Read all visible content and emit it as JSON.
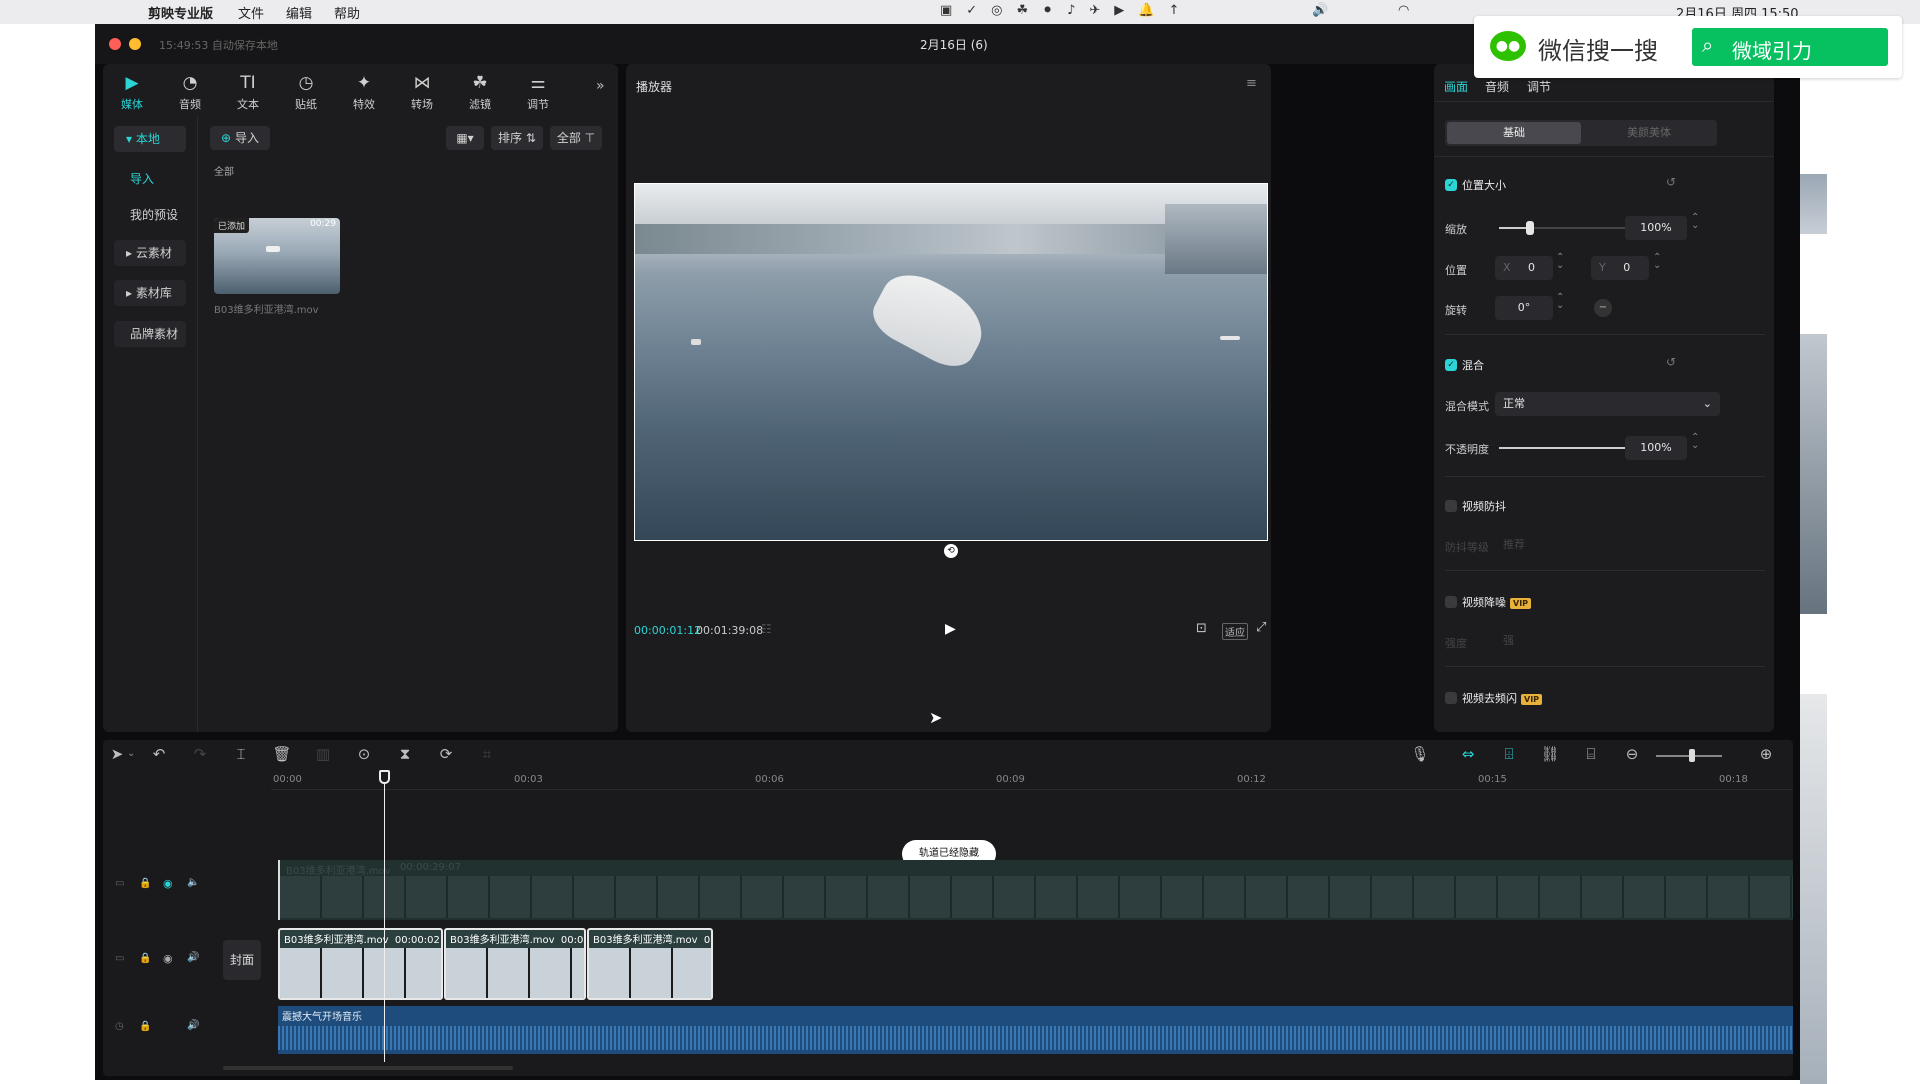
{
  "menubar": {
    "app": "剪映专业版",
    "items": [
      "文件",
      "编辑",
      "帮助"
    ],
    "clock": "2月16日 周四 15:50"
  },
  "window": {
    "title": "2月16日 (6)",
    "autosave": "15:49:53 自动保存本地"
  },
  "toolbar": [
    {
      "icon": "media-icon",
      "label": "媒体"
    },
    {
      "icon": "audio-icon",
      "label": "音频"
    },
    {
      "icon": "text-icon",
      "label": "文本"
    },
    {
      "icon": "sticker-icon",
      "label": "贴纸"
    },
    {
      "icon": "effects-icon",
      "label": "特效"
    },
    {
      "icon": "transition-icon",
      "label": "转场"
    },
    {
      "icon": "filter-icon",
      "label": "滤镜"
    },
    {
      "icon": "adjust-icon",
      "label": "调节"
    }
  ],
  "sidebar": {
    "local": "本地",
    "import": "导入",
    "presets": "我的预设",
    "cloud": "云素材",
    "library": "素材库",
    "brand": "品牌素材"
  },
  "media": {
    "import_btn": "导入",
    "sort": "排序",
    "filter": "全部",
    "section": "全部",
    "clip": {
      "badge": "已添加",
      "duration": "00:29",
      "filename": "B03维多利亚港湾.mov"
    }
  },
  "player": {
    "title": "播放器",
    "current": "00:00:01:12",
    "total": "00:01:39:08",
    "ratio": "适应"
  },
  "props": {
    "tabs": [
      "画面",
      "音频",
      "调节"
    ],
    "subtabs": [
      "基础",
      "美颜美体"
    ],
    "position_size": "位置大小",
    "scale_label": "缩放",
    "scale": "100%",
    "scale_level": 0.22,
    "pos_label": "位置",
    "x_label": "X",
    "x": "0",
    "y_label": "Y",
    "y": "0",
    "rot_label": "旋转",
    "rot": "0°",
    "blend": "混合",
    "blend_mode_label": "混合模式",
    "blend_mode": "正常",
    "opacity_label": "不透明度",
    "opacity": "100%",
    "opacity_level": 1.0,
    "stabilize": "视频防抖",
    "stab_level_label": "防抖等级",
    "stab_level": "推荐",
    "denoise": "视频降噪",
    "vip": "VIP",
    "strength_label": "强度",
    "strength": "强",
    "deflicker": "视频去频闪"
  },
  "timeline": {
    "ticks": [
      "00:00",
      "00:03",
      "00:06",
      "00:09",
      "00:12",
      "00:15",
      "00:18"
    ],
    "hidden_toast": "轨道已经隐藏",
    "hidden_clip": "B03维多利亚港湾.mov",
    "hidden_dur": "00:00:29:07",
    "cover": "封面",
    "clips": [
      {
        "name": "B03维多利亚港湾.mov",
        "dur": "00:00:02"
      },
      {
        "name": "B03维多利亚港湾.mov",
        "dur": "00:0"
      },
      {
        "name": "B03维多利亚港湾.mov",
        "dur": "0"
      }
    ],
    "audio": "震撼大气开场音乐"
  },
  "wechat": {
    "label": "微信搜一搜",
    "search": "微域引力"
  },
  "colors": {
    "accent": "#2bd5d5",
    "panel": "#1c1c1f",
    "audio": "#1e4c7c"
  }
}
